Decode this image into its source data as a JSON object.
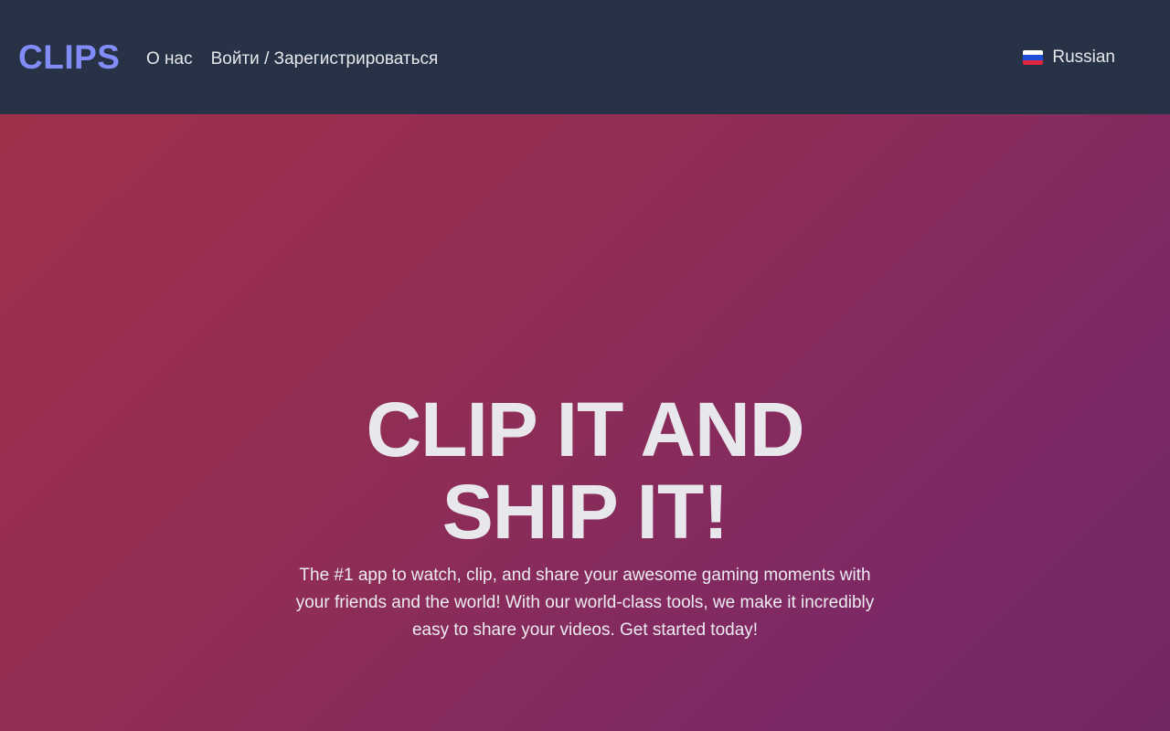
{
  "nav": {
    "brand": "CLIPS",
    "links": [
      "О нас",
      "Войти / Зарегистрироваться"
    ],
    "language": {
      "label": "Russian",
      "flag_icon": "russia-flag-icon"
    }
  },
  "hero": {
    "title_line1": "CLIP IT AND",
    "title_line2": "SHIP IT!",
    "description": "The #1 app to watch, clip, and share your awesome gaming moments with your friends and the world! With our world-class tools, we make it incredibly easy to share your videos. Get started today!"
  },
  "colors": {
    "nav_background": "#283246",
    "brand": "#818cf8",
    "hero_gradient_start": "#a1304a",
    "hero_gradient_end": "#722765"
  }
}
